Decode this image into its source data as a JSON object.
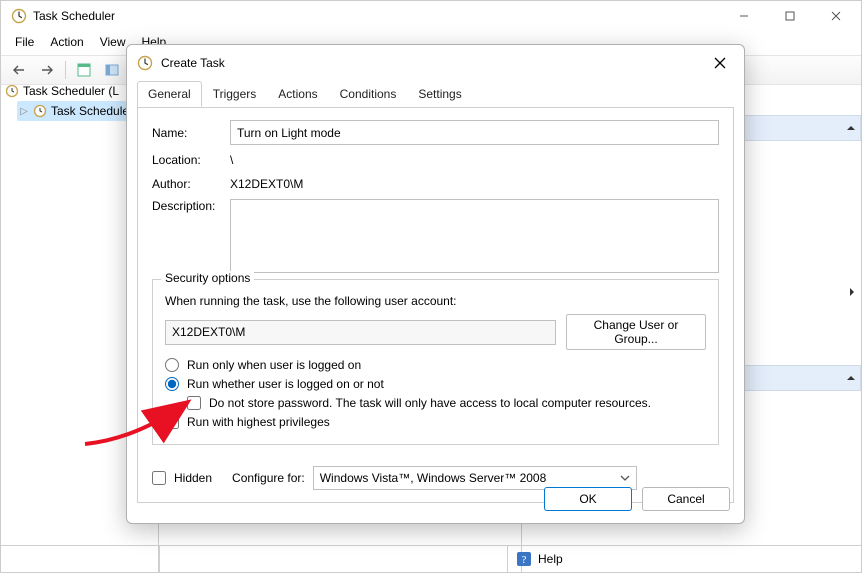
{
  "window": {
    "title": "Task Scheduler",
    "menu": [
      "File",
      "Action",
      "View",
      "Help"
    ]
  },
  "tree": {
    "root": "Task Scheduler (L",
    "child": "Task Schedule"
  },
  "actions_panel": {
    "help": "Help"
  },
  "dialog": {
    "title": "Create Task",
    "tabs": [
      "General",
      "Triggers",
      "Actions",
      "Conditions",
      "Settings"
    ],
    "form": {
      "name_label": "Name:",
      "name_value": "Turn on Light mode",
      "location_label": "Location:",
      "location_value": "\\",
      "author_label": "Author:",
      "author_value": "X12DEXT0\\M",
      "description_label": "Description:",
      "description_value": ""
    },
    "security": {
      "legend": "Security options",
      "prompt": "When running the task, use the following user account:",
      "account": "X12DEXT0\\M",
      "change_button": "Change User or Group...",
      "radio_logged_on": "Run only when user is logged on",
      "radio_logged_or_not": "Run whether user is logged on or not",
      "chk_no_password": "Do not store password.  The task will only have access to local computer resources.",
      "chk_highest": "Run with highest privileges"
    },
    "hidden_label": "Hidden",
    "configure_label": "Configure for:",
    "configure_value": "Windows Vista™, Windows Server™ 2008",
    "ok": "OK",
    "cancel": "Cancel"
  }
}
